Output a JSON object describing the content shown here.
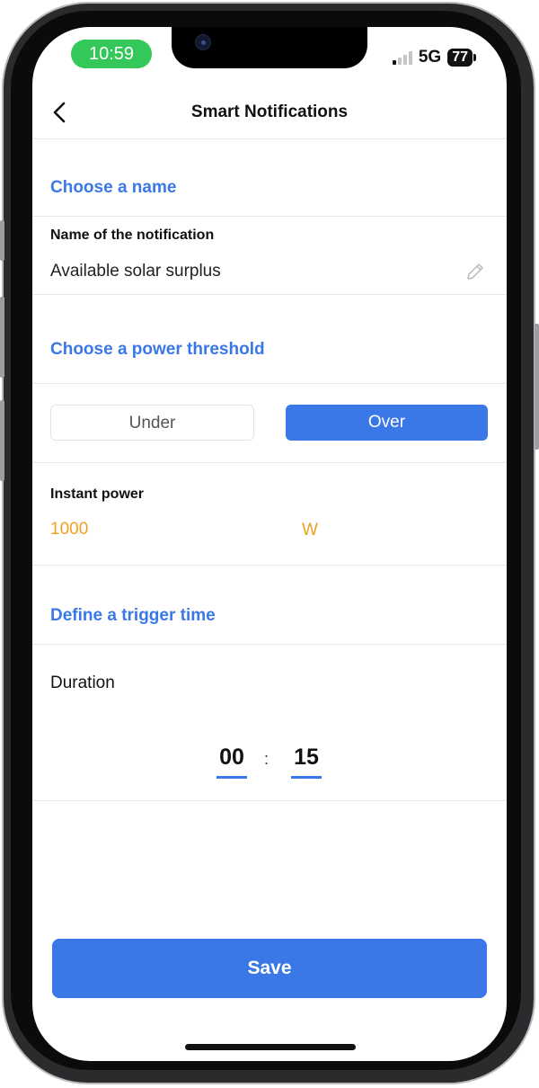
{
  "status_bar": {
    "time": "10:59",
    "network": "5G",
    "battery": "77",
    "time_pill_color": "#34c759"
  },
  "header": {
    "title": "Smart Notifications",
    "back_icon": "chevron-left-icon"
  },
  "name_section": {
    "title": "Choose a name",
    "field_label": "Name of the notification",
    "field_value": "Available solar surplus",
    "edit_icon": "pencil-icon"
  },
  "threshold_section": {
    "title": "Choose a power threshold",
    "options": [
      "Under",
      "Over"
    ],
    "selected": "Over",
    "power_label": "Instant power",
    "power_value": "1000",
    "power_unit": "W"
  },
  "trigger_section": {
    "title": "Define a trigger time",
    "duration_label": "Duration",
    "hours": "00",
    "separator": ":",
    "minutes": "15"
  },
  "footer": {
    "save_label": "Save"
  },
  "colors": {
    "accent": "#3b78e7",
    "value_orange": "#f0a020"
  }
}
